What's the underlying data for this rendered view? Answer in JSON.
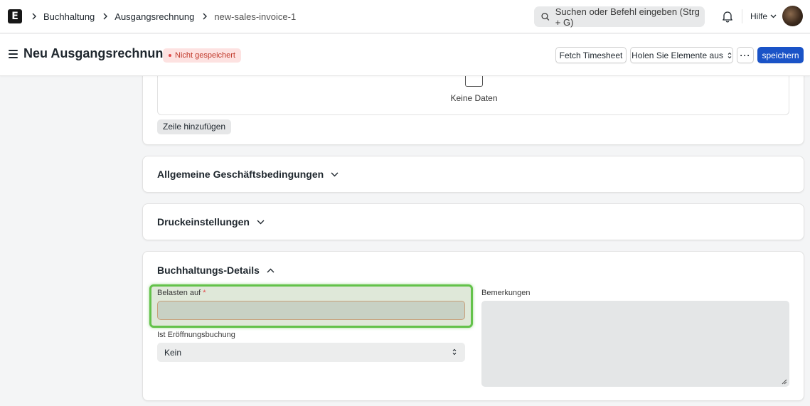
{
  "navbar": {
    "logo": "E",
    "breadcrumbs": [
      "Buchhaltung",
      "Ausgangsrechnung",
      "new-sales-invoice-1"
    ],
    "search_placeholder": "Suchen oder Befehl eingeben (Strg + G)",
    "help_label": "Hilfe"
  },
  "page": {
    "title": "Neu Ausgangsrechnung",
    "status_badge": "Nicht gespeichert",
    "buttons": {
      "fetch_timesheet": "Fetch Timesheet",
      "get_items_from": "Holen Sie Elemente aus",
      "more": "···",
      "save": "speichern"
    }
  },
  "items_table": {
    "empty_text": "Keine Daten",
    "add_row_label": "Zeile hinzufügen"
  },
  "sections": {
    "terms": "Allgemeine Geschäftsbedingungen",
    "print_settings": "Druckeinstellungen",
    "accounting": "Buchhaltungs-Details"
  },
  "accounting_fields": {
    "debit_to_label": "Belasten auf",
    "debit_to_required": "*",
    "debit_to_value": "",
    "is_opening_label": "Ist Eröffnungsbuchung",
    "is_opening_value": "Kein",
    "remarks_label": "Bemerkungen",
    "remarks_value": ""
  },
  "colors": {
    "primary": "#1a53c7",
    "highlight": "#63c24a",
    "unsaved": "#c0392b"
  }
}
